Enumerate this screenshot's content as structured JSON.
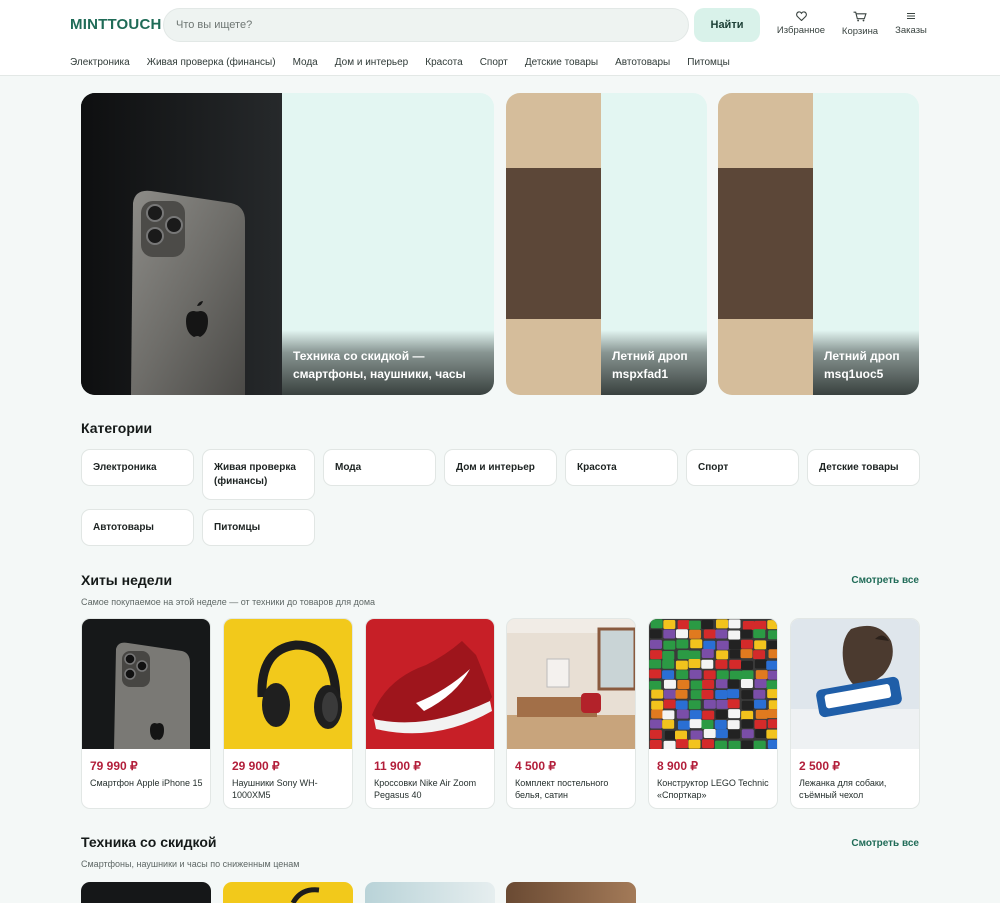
{
  "header": {
    "logo": "MINTTOUCH",
    "search_placeholder": "Что вы ищете?",
    "search_button": "Найти",
    "actions": [
      {
        "label": "Избранное",
        "icon": "heart-icon"
      },
      {
        "label": "Корзина",
        "icon": "cart-icon"
      },
      {
        "label": "Заказы",
        "icon": "menu-icon"
      }
    ]
  },
  "nav": [
    "Электроника",
    "Живая проверка (финансы)",
    "Мода",
    "Дом и интерьер",
    "Красота",
    "Спорт",
    "Детские товары",
    "Автотовары",
    "Питомцы"
  ],
  "banners": [
    {
      "line1": "Техника со скидкой —",
      "line2": "смартфоны, наушники, часы"
    },
    {
      "line1": "Летний дроп",
      "line2": "mspxfad1"
    },
    {
      "line1": "Летний дроп",
      "line2": "msq1uoc5"
    }
  ],
  "categories": {
    "title": "Категории",
    "items": [
      "Электроника",
      "Живая проверка (финансы)",
      "Мода",
      "Дом и интерьер",
      "Красота",
      "Спорт",
      "Детские товары",
      "Автотовары",
      "Питомцы"
    ]
  },
  "hits": {
    "title": "Хиты недели",
    "subtitle": "Самое покупаемое на этой неделе — от техники до товаров для дома",
    "see_all": "Смотреть все",
    "products": [
      {
        "price": "79 990 ₽",
        "name": "Смартфон Apple iPhone 15"
      },
      {
        "price": "29 900 ₽",
        "name": "Наушники Sony WH-1000XM5"
      },
      {
        "price": "11 900 ₽",
        "name": "Кроссовки Nike Air Zoom Pegasus 40"
      },
      {
        "price": "4 500 ₽",
        "name": "Комплект постельного белья, сатин"
      },
      {
        "price": "8 900 ₽",
        "name": "Конструктор LEGO Technic «Спорткар»"
      },
      {
        "price": "2 500 ₽",
        "name": "Лежанка для собаки, съёмный чехол"
      }
    ]
  },
  "discount": {
    "title": "Техника со скидкой",
    "subtitle": "Смартфоны, наушники и часы по сниженным ценам",
    "see_all": "Смотреть все"
  },
  "colors": {
    "brand": "#1f6b57",
    "price": "#b21e3a",
    "accent_bg": "#d9f2ea"
  }
}
